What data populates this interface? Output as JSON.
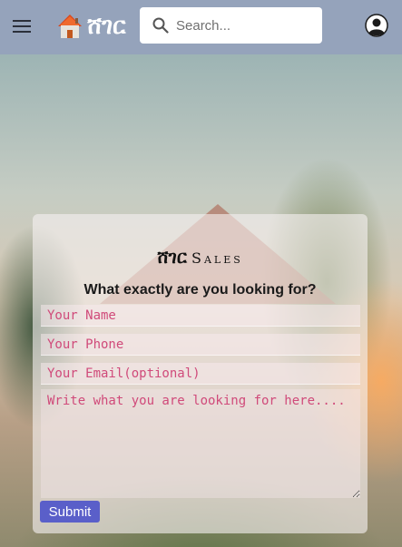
{
  "navbar": {
    "menu_icon": "hamburger-menu-icon",
    "logo_icon": "house-icon",
    "brand": "ሸገር",
    "search": {
      "placeholder": "Search...",
      "icon": "search-icon"
    },
    "account_icon": "user-account-icon",
    "background_color": "#95a3bb"
  },
  "form": {
    "title_main": "ሸገር",
    "title_sub": "Sales",
    "question": "What exactly are you looking for?",
    "name_placeholder": "Your Name",
    "phone_placeholder": "Your Phone",
    "email_placeholder": "Your Email(optional)",
    "message_placeholder": "Write what you are looking for here....",
    "submit_label": "Submit",
    "accent_color": "#5a5fc9",
    "placeholder_color": "#d04a7a"
  }
}
